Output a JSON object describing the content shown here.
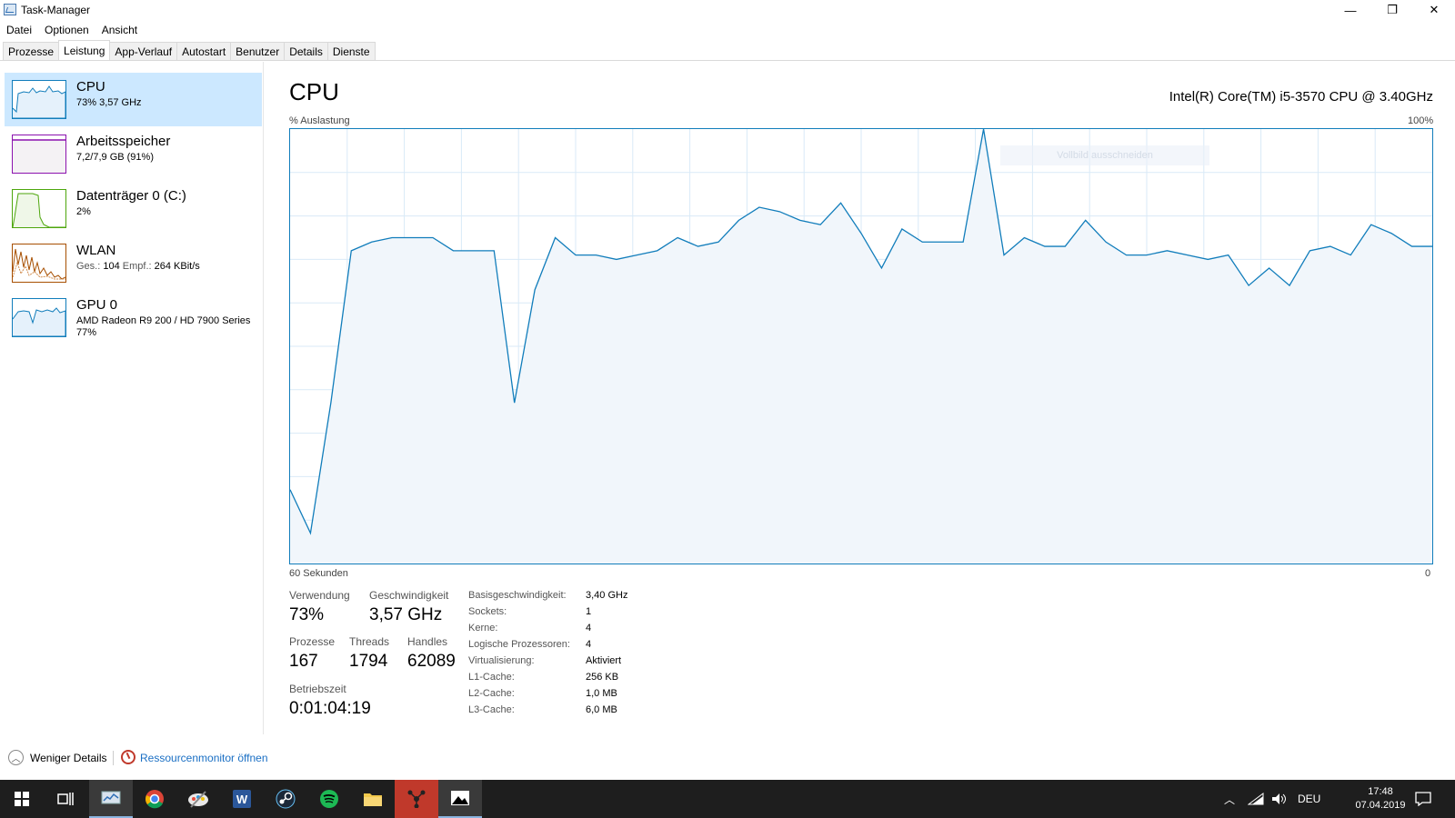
{
  "window": {
    "title": "Task-Manager",
    "controls": {
      "minimize": "—",
      "restore": "❐",
      "close": "✕"
    }
  },
  "menu": [
    "Datei",
    "Optionen",
    "Ansicht"
  ],
  "tabs": [
    "Prozesse",
    "Leistung",
    "App-Verlauf",
    "Autostart",
    "Benutzer",
    "Details",
    "Dienste"
  ],
  "active_tab": "Leistung",
  "sidebar": {
    "items": [
      {
        "name": "CPU",
        "detail": "73% 3,57 GHz",
        "color": "#117dbb",
        "active": true
      },
      {
        "name": "Arbeitsspeicher",
        "detail": "7,2/7,9 GB (91%)",
        "color": "#8b12ae"
      },
      {
        "name": "Datenträger 0 (C:)",
        "detail": "2%",
        "color": "#4da60c"
      },
      {
        "name": "WLAN",
        "detail_prefix": "Ges.:",
        "detail_mid": "104",
        "detail_suffix": "Empf.:",
        "detail_end": "264 KBit/s",
        "color": "#a74f01"
      },
      {
        "name": "GPU 0",
        "detail": "AMD Radeon R9 200 / HD 7900 Series",
        "detail2": "77%",
        "color": "#117dbb"
      }
    ]
  },
  "main": {
    "title": "CPU",
    "model": "Intel(R) Core(TM) i5-3570 CPU @ 3.40GHz",
    "y_label": "% Auslastung",
    "y_max_label": "100%",
    "x_left_label": "60 Sekunden",
    "x_right_label": "0",
    "ghost_text": "Vollbild ausschneiden"
  },
  "chart_data": {
    "type": "area",
    "title": "",
    "ylabel": "% Auslastung",
    "ylim": [
      0,
      100
    ],
    "xlim": [
      60,
      0
    ],
    "grid": true,
    "color": "#117dbb",
    "x": [
      60,
      59,
      58,
      57,
      56,
      55,
      54,
      53,
      52,
      51,
      50,
      49,
      48,
      47,
      46,
      45,
      44,
      43,
      42,
      41,
      40,
      39,
      38,
      37,
      36,
      35,
      34,
      33,
      32,
      31,
      30,
      29,
      28,
      27,
      26,
      25,
      24,
      23,
      22,
      21,
      20,
      19,
      18,
      17,
      16,
      15,
      14,
      13,
      12,
      11,
      10,
      9,
      8,
      7,
      6,
      5,
      4,
      3,
      2,
      1,
      0
    ],
    "values": [
      17,
      7,
      37,
      72,
      74,
      75,
      75,
      75,
      72,
      72,
      72,
      37,
      63,
      75,
      71,
      71,
      70,
      71,
      72,
      75,
      73,
      74,
      79,
      82,
      81,
      79,
      78,
      83,
      76,
      68,
      77,
      74,
      74,
      74,
      100,
      71,
      75,
      73,
      73,
      79,
      74,
      71,
      71,
      72,
      71,
      70,
      71,
      64,
      68,
      64,
      72,
      73,
      71,
      78,
      76,
      73,
      73
    ]
  },
  "stats": {
    "usage_label": "Verwendung",
    "usage_value": "73%",
    "speed_label": "Geschwindigkeit",
    "speed_value": "3,57 GHz",
    "processes_label": "Prozesse",
    "processes_value": "167",
    "threads_label": "Threads",
    "threads_value": "1794",
    "handles_label": "Handles",
    "handles_value": "62089",
    "uptime_label": "Betriebszeit",
    "uptime_value": "0:01:04:19"
  },
  "info": [
    {
      "key": "Basisgeschwindigkeit:",
      "value": "3,40 GHz"
    },
    {
      "key": "Sockets:",
      "value": "1"
    },
    {
      "key": "Kerne:",
      "value": "4"
    },
    {
      "key": "Logische Prozessoren:",
      "value": "4"
    },
    {
      "key": "Virtualisierung:",
      "value": "Aktiviert"
    },
    {
      "key": "L1-Cache:",
      "value": "256 KB"
    },
    {
      "key": "L2-Cache:",
      "value": "1,0 MB"
    },
    {
      "key": "L3-Cache:",
      "value": "6,0 MB"
    }
  ],
  "footer": {
    "less_details": "Weniger Details",
    "resource_monitor": "Ressourcenmonitor öffnen"
  },
  "taskbar": {
    "apps": [
      "windows-start-icon",
      "task-view-icon",
      "task-manager-icon",
      "chrome-icon",
      "paint-icon",
      "word-icon",
      "steam-icon",
      "spotify-icon",
      "file-explorer-icon",
      "app-red-icon",
      "photos-icon"
    ],
    "language": "DEU",
    "time": "17:48",
    "date": "07.04.2019"
  }
}
